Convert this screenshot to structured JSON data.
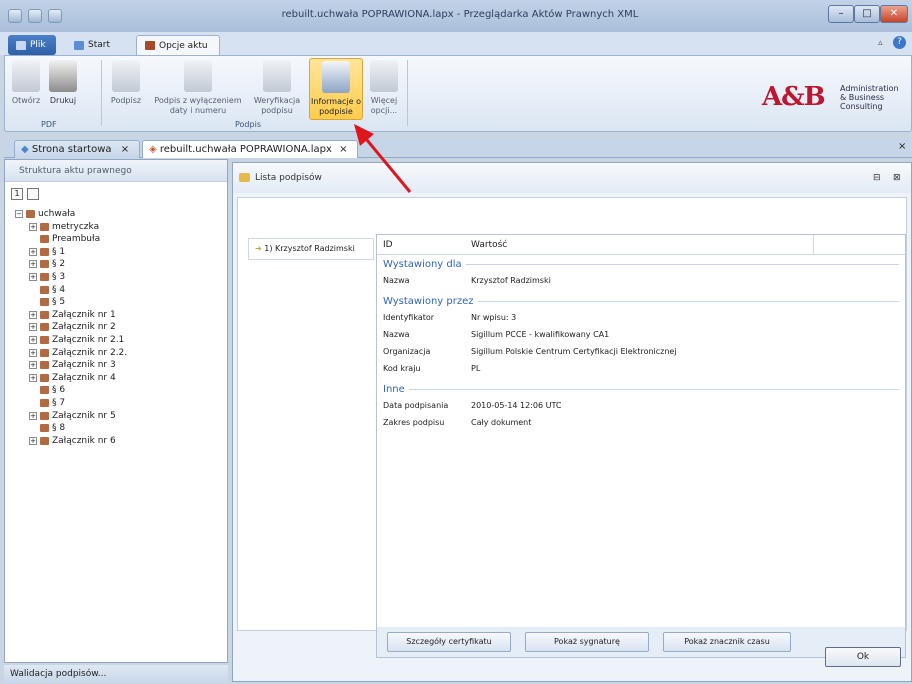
{
  "window": {
    "title": "rebuilt.uchwała POPRAWIONA.lapx - Przeglądarka Aktów Prawnych XML",
    "controls": {
      "minimize": "–",
      "maximize": "□",
      "close": "✕"
    }
  },
  "ribbon_tabs": [
    {
      "label": "Plik"
    },
    {
      "label": "Start"
    },
    {
      "label": "Opcje aktu"
    }
  ],
  "ribbon": {
    "buttons": [
      {
        "label": "Otwórz",
        "icon": "open-document-icon"
      },
      {
        "label": "Drukuj",
        "icon": "printer-icon"
      },
      {
        "label": "Podpisz",
        "icon": "sign-icon"
      },
      {
        "label": "Podpis z wyłączeniem daty i numeru",
        "icon": "sign-partial-icon"
      },
      {
        "label": "Weryfikacja podpisu",
        "icon": "verify-signature-icon"
      },
      {
        "label": "Informacje o podpisie",
        "icon": "signature-info-icon"
      },
      {
        "label": "Więcej opcji...",
        "icon": "more-options-icon"
      }
    ],
    "groups": {
      "pdf": "PDF",
      "podpis": "Podpis"
    }
  },
  "logo": {
    "text": "A&B",
    "tagline": "Administration & Business Consulting"
  },
  "doc_tabs": [
    {
      "label": "Strona startowa"
    },
    {
      "label": "rebuilt.uchwała POPRAWIONA.lapx"
    }
  ],
  "tree": {
    "header": "Struktura aktu prawnego",
    "items": [
      {
        "label": "uchwała",
        "expander": "−"
      },
      {
        "label": "metryczka",
        "expander": "+"
      },
      {
        "label": "Preambuła",
        "expander": ""
      },
      {
        "label": "§ 1",
        "expander": "+"
      },
      {
        "label": "§ 2",
        "expander": "+"
      },
      {
        "label": "§ 3",
        "expander": "+"
      },
      {
        "label": "§ 4",
        "expander": ""
      },
      {
        "label": "§ 5",
        "expander": ""
      },
      {
        "label": "Załącznik nr 1",
        "expander": "+"
      },
      {
        "label": "Załącznik nr 2",
        "expander": "+"
      },
      {
        "label": "Załącznik nr 2.1",
        "expander": "+"
      },
      {
        "label": "Załącznik nr 2.2.",
        "expander": "+"
      },
      {
        "label": "Załącznik nr 3",
        "expander": "+"
      },
      {
        "label": "Załącznik nr 4",
        "expander": "+"
      },
      {
        "label": "§ 6",
        "expander": ""
      },
      {
        "label": "§ 7",
        "expander": ""
      },
      {
        "label": "Załącznik nr 5",
        "expander": "+"
      },
      {
        "label": "§ 8",
        "expander": ""
      },
      {
        "label": "Załącznik nr 6",
        "expander": "+"
      }
    ]
  },
  "status_bar": {
    "text": "Walidacja podpisów..."
  },
  "dialog": {
    "title": "Lista podpisów",
    "signature_item": "1) Krzysztof Radzimski",
    "columns": {
      "id": "ID",
      "value": "Wartość"
    },
    "sections": [
      {
        "title": "Wystawiony dla",
        "rows": [
          {
            "key": "Nazwa",
            "value": "Krzysztof Radzimski"
          }
        ]
      },
      {
        "title": "Wystawiony przez",
        "rows": [
          {
            "key": "Identyfikator",
            "value": "Nr wpisu: 3"
          },
          {
            "key": "Nazwa",
            "value": "Sigillum PCCE - kwalifikowany CA1"
          },
          {
            "key": "Organizacja",
            "value": "Sigillum Polskie Centrum Certyfikacji Elektronicznej"
          },
          {
            "key": "Kod kraju",
            "value": "PL"
          }
        ]
      },
      {
        "title": "Inne",
        "rows": [
          {
            "key": "Data podpisania",
            "value": "2010-05-14 12:06 UTC"
          },
          {
            "key": "Zakres podpisu",
            "value": "Cały dokument"
          }
        ]
      }
    ],
    "buttons": {
      "details": "Szczegóły certyfikatu",
      "signature": "Pokaż sygnaturę",
      "timestamp": "Pokaż znacznik czasu",
      "ok": "Ok"
    }
  },
  "colors": {
    "accent": "#2f67b3",
    "highlight": "#ffcc4b",
    "logo": "#c0152e",
    "arrow": "#e0141c"
  }
}
